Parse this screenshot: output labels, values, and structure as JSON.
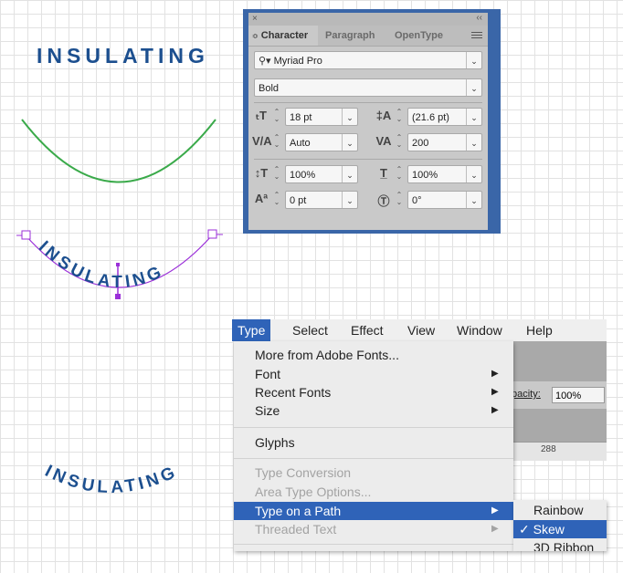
{
  "artwork": {
    "title_text": "INSULATING",
    "path_text": "INSULATING",
    "skew_text": "INSULATING",
    "colors": {
      "text": "#1c4f8f",
      "path_green": "#3aaa4a",
      "selection": "#9b30d9"
    }
  },
  "character_panel": {
    "close_glyph": "×",
    "collapse_glyph": "‹‹",
    "tabs": [
      {
        "label": "Character",
        "active": true
      },
      {
        "label": "Paragraph",
        "active": false
      },
      {
        "label": "OpenType",
        "active": false
      }
    ],
    "font_family": "Myriad Pro",
    "font_style": "Bold",
    "font_size": "18 pt",
    "leading": "(21.6 pt)",
    "kerning": "Auto",
    "tracking": "200",
    "vertical_scale": "100%",
    "horizontal_scale": "100%",
    "baseline_shift": "0 pt",
    "character_rotation": "0°"
  },
  "menubar": {
    "items": [
      "Type",
      "Select",
      "Effect",
      "View",
      "Window",
      "Help"
    ],
    "active": "Type"
  },
  "background_ui": {
    "opacity_label": "pacity:",
    "opacity_value": "100%",
    "ruler_mark": "288"
  },
  "type_menu": {
    "items": [
      {
        "label": "More from Adobe Fonts...",
        "submenu": false,
        "disabled": false
      },
      {
        "label": "Font",
        "submenu": true,
        "disabled": false
      },
      {
        "label": "Recent Fonts",
        "submenu": true,
        "disabled": false
      },
      {
        "label": "Size",
        "submenu": true,
        "disabled": false
      },
      {
        "label": "Glyphs",
        "submenu": false,
        "disabled": false
      },
      {
        "label": "Type Conversion",
        "submenu": false,
        "disabled": true
      },
      {
        "label": "Area Type Options...",
        "submenu": false,
        "disabled": true
      },
      {
        "label": "Type on a Path",
        "submenu": true,
        "disabled": false,
        "highlighted": true
      },
      {
        "label": "Threaded Text",
        "submenu": true,
        "disabled": true
      }
    ]
  },
  "type_on_path_submenu": {
    "items": [
      {
        "label": "Rainbow",
        "checked": false
      },
      {
        "label": "✓ Skew",
        "checked": true
      },
      {
        "label": "3D Ribbon",
        "checked": false
      }
    ]
  }
}
